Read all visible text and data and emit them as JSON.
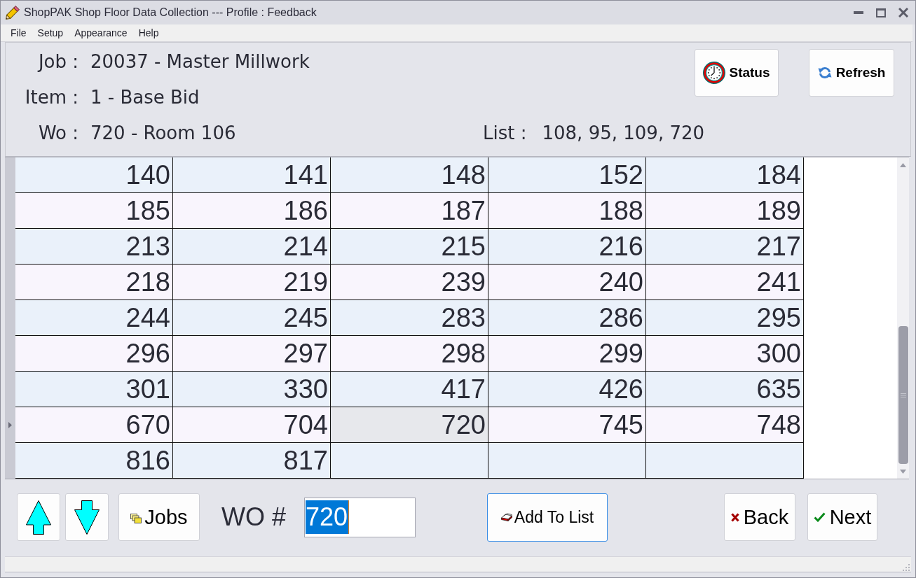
{
  "window": {
    "title": "ShopPAK Shop Floor Data Collection --- Profile : Feedback"
  },
  "menu": [
    "File",
    "Setup",
    "Appearance",
    "Help"
  ],
  "header": {
    "fields": [
      {
        "label": "Job :",
        "value": "20037 - Master Millwork"
      },
      {
        "label": "Item :",
        "value": "1 - Base Bid"
      },
      {
        "label": "Wo :",
        "value": "720 - Room 106"
      }
    ],
    "list": {
      "label": "List :",
      "value": "108, 95, 109, 720"
    },
    "buttons": [
      {
        "kind": "status",
        "label": "Status"
      },
      {
        "kind": "refresh",
        "label": "Refresh"
      }
    ]
  },
  "grid": {
    "rows": [
      {
        "current": false,
        "cells": [
          {
            "text": "140",
            "selected": false
          },
          {
            "text": "141",
            "selected": false
          },
          {
            "text": "148",
            "selected": false
          },
          {
            "text": "152",
            "selected": false
          },
          {
            "text": "184",
            "selected": false
          }
        ]
      },
      {
        "current": false,
        "cells": [
          {
            "text": "185",
            "selected": false
          },
          {
            "text": "186",
            "selected": false
          },
          {
            "text": "187",
            "selected": false
          },
          {
            "text": "188",
            "selected": false
          },
          {
            "text": "189",
            "selected": false
          }
        ]
      },
      {
        "current": false,
        "cells": [
          {
            "text": "213",
            "selected": false
          },
          {
            "text": "214",
            "selected": false
          },
          {
            "text": "215",
            "selected": false
          },
          {
            "text": "216",
            "selected": false
          },
          {
            "text": "217",
            "selected": false
          }
        ]
      },
      {
        "current": false,
        "cells": [
          {
            "text": "218",
            "selected": false
          },
          {
            "text": "219",
            "selected": false
          },
          {
            "text": "239",
            "selected": false
          },
          {
            "text": "240",
            "selected": false
          },
          {
            "text": "241",
            "selected": false
          }
        ]
      },
      {
        "current": false,
        "cells": [
          {
            "text": "244",
            "selected": false
          },
          {
            "text": "245",
            "selected": false
          },
          {
            "text": "283",
            "selected": false
          },
          {
            "text": "286",
            "selected": false
          },
          {
            "text": "295",
            "selected": false
          }
        ]
      },
      {
        "current": false,
        "cells": [
          {
            "text": "296",
            "selected": false
          },
          {
            "text": "297",
            "selected": false
          },
          {
            "text": "298",
            "selected": false
          },
          {
            "text": "299",
            "selected": false
          },
          {
            "text": "300",
            "selected": false
          }
        ]
      },
      {
        "current": false,
        "cells": [
          {
            "text": "301",
            "selected": false
          },
          {
            "text": "330",
            "selected": false
          },
          {
            "text": "417",
            "selected": false
          },
          {
            "text": "426",
            "selected": false
          },
          {
            "text": "635",
            "selected": false
          }
        ]
      },
      {
        "current": true,
        "cells": [
          {
            "text": "670",
            "selected": false
          },
          {
            "text": "704",
            "selected": false
          },
          {
            "text": "720",
            "selected": true
          },
          {
            "text": "745",
            "selected": false
          },
          {
            "text": "748",
            "selected": false
          }
        ]
      },
      {
        "current": false,
        "cells": [
          {
            "text": "816",
            "selected": false
          },
          {
            "text": "817",
            "selected": false
          }
        ]
      }
    ]
  },
  "footer": {
    "jobs_button": {
      "label": "Jobs"
    },
    "wo_field": {
      "label": "WO #",
      "value": "720",
      "text_selected": true
    },
    "add_button": {
      "label": "Add To List",
      "focused": true
    },
    "buttons": [
      {
        "kind": "back",
        "label": "Back"
      },
      {
        "kind": "next",
        "label": "Next"
      }
    ]
  }
}
